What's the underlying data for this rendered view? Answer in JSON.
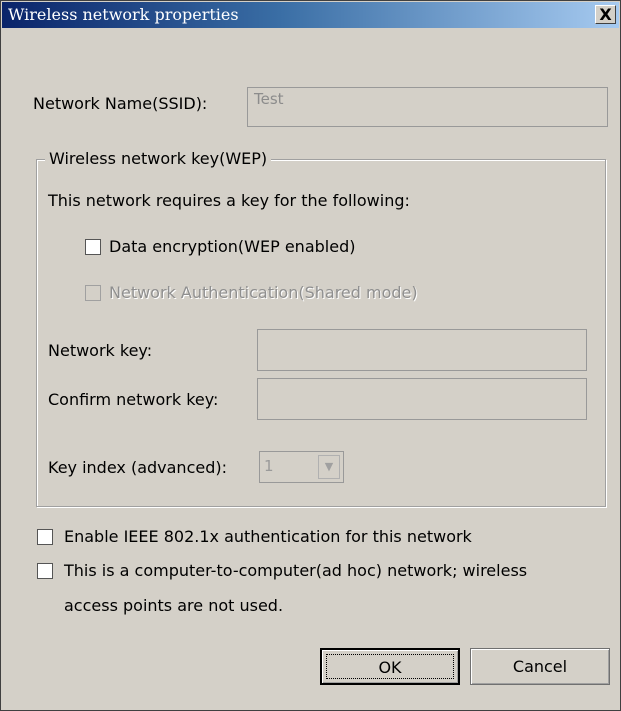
{
  "window": {
    "title": "Wireless network properties",
    "close_label": "X"
  },
  "ssid": {
    "label": "Network Name(SSID):",
    "value": "Test"
  },
  "wep": {
    "legend": "Wireless network key(WEP)",
    "description": "This network requires a key for the following:",
    "data_encryption": {
      "label": "Data encryption(WEP enabled)",
      "checked": false
    },
    "network_auth": {
      "label": "Network Authentication(Shared mode)",
      "checked": false,
      "disabled": true
    },
    "network_key_label": "Network key:",
    "network_key_value": "",
    "confirm_key_label": "Confirm network key:",
    "confirm_key_value": "",
    "key_index_label": "Key index (advanced):",
    "key_index_value": "1"
  },
  "options": {
    "ieee_8021x": {
      "label": "Enable IEEE 802.1x authentication for this network",
      "checked": false
    },
    "adhoc": {
      "label_line1": "This is a computer-to-computer(ad hoc) network; wireless",
      "label_line2": "access points are not used.",
      "checked": false
    }
  },
  "buttons": {
    "ok": "OK",
    "cancel": "Cancel"
  },
  "colors": {
    "dialog_bg": "#d4d0c8",
    "title_start": "#0a246a",
    "title_end": "#a6caf0",
    "disabled_text": "#8f8f8f"
  },
  "icons": {
    "close": "close-icon",
    "combo_arrow": "chevron-down-icon"
  }
}
